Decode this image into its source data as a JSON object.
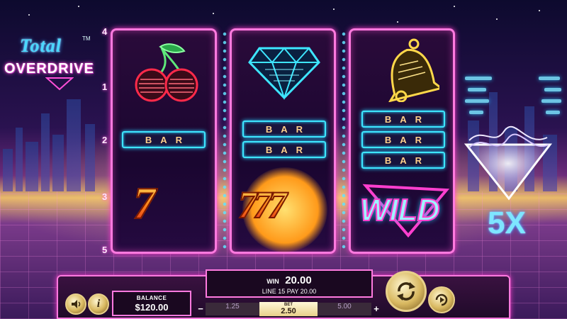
{
  "game": {
    "logo_top": "Total",
    "logo_tm": "TM",
    "logo_bottom": "OVERDRIVE"
  },
  "paylines": {
    "left": [
      "4",
      "1",
      "2",
      "3",
      "5"
    ]
  },
  "reels": [
    {
      "symbols": [
        "cherry",
        "BAR",
        "7"
      ]
    },
    {
      "symbols": [
        "diamond",
        "BAR",
        "BAR",
        "777"
      ]
    },
    {
      "symbols": [
        "bell",
        "BAR",
        "BAR",
        "BAR",
        "WILD"
      ]
    }
  ],
  "symbols": {
    "bar_label": "BAR",
    "seven": "7",
    "triple_seven": "777",
    "wild": "WILD"
  },
  "multiplier": {
    "label": "5X"
  },
  "panel": {
    "balance_label": "BALANCE",
    "balance_value": "$120.00",
    "win_label": "WIN",
    "win_value": "20.00",
    "win_detail": "LINE 15 PAY 20.00",
    "bet_prev": "1.25",
    "bet_label": "BET",
    "bet_value": "2.50",
    "bet_next": "5.00",
    "bet_minus": "−",
    "bet_plus": "+"
  },
  "colors": {
    "neon_pink": "#ff7adf",
    "neon_cyan": "#3ee6ff",
    "gold": "#e8d08a"
  },
  "icons": {
    "sound": "speaker-icon",
    "info": "info-icon",
    "spin": "spin-arrows-icon",
    "autoplay": "autoplay-icon"
  }
}
